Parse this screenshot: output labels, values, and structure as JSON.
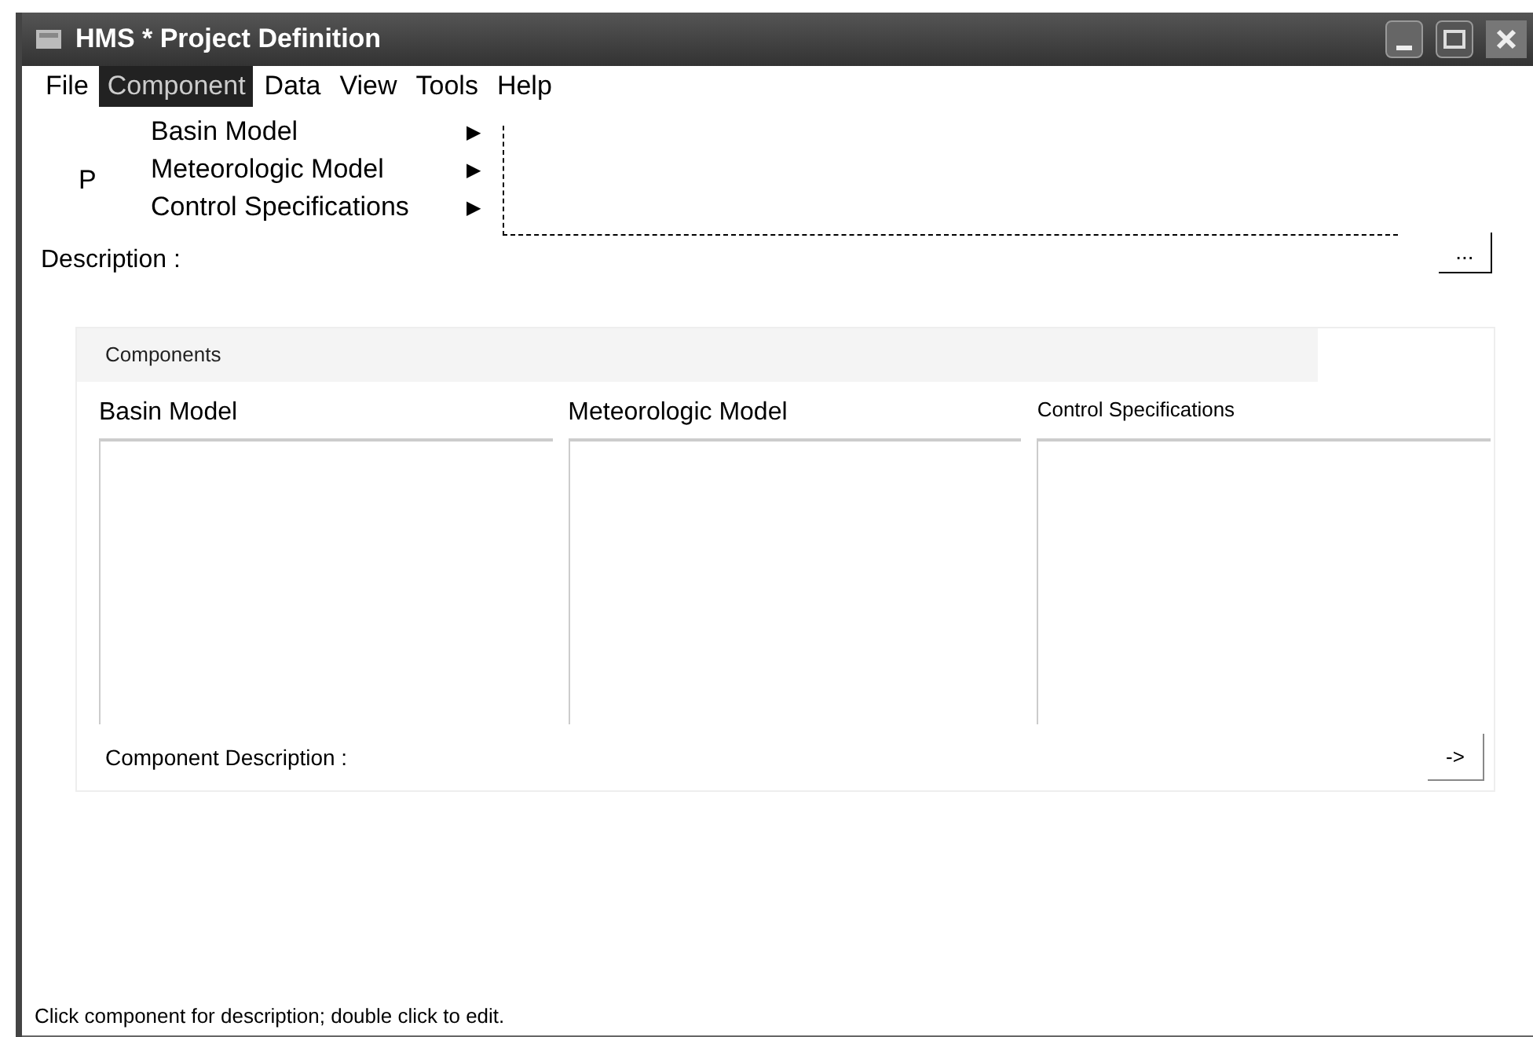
{
  "window": {
    "title": "HMS * Project Definition"
  },
  "menu_bar": [
    {
      "label": "File",
      "selected": false
    },
    {
      "label": "Component",
      "selected": true
    },
    {
      "label": "Data",
      "selected": false
    },
    {
      "label": "View",
      "selected": false
    },
    {
      "label": "Tools",
      "selected": false
    },
    {
      "label": "Help",
      "selected": false
    }
  ],
  "open_menu": [
    {
      "label": "Basin Model",
      "submenu_arrow": "▶"
    },
    {
      "label": "Meteorologic Model",
      "submenu_arrow": "▶"
    },
    {
      "label": "Control Specifications",
      "submenu_arrow": "▶"
    }
  ],
  "project_label": "P",
  "description": {
    "label": "Description :",
    "button": "..."
  },
  "components": {
    "title": "Components",
    "columns": [
      "Basin Model",
      "Meteorologic Model",
      "Control Specifications"
    ],
    "component_description": {
      "label": "Component Description :",
      "button": "->"
    }
  },
  "status_bar": "Click component for description; double click to edit."
}
